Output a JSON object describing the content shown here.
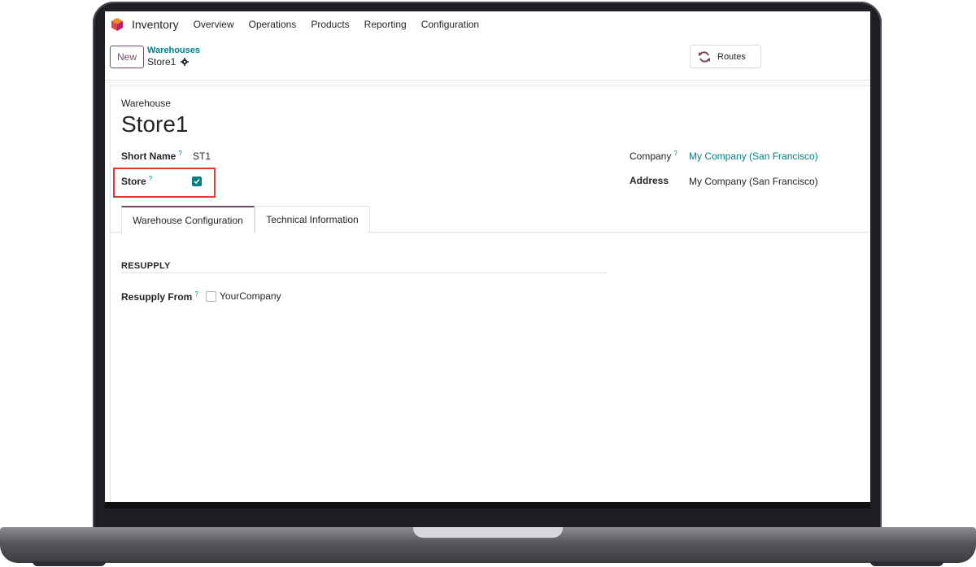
{
  "navbar": {
    "app_name": "Inventory",
    "items": [
      "Overview",
      "Operations",
      "Products",
      "Reporting",
      "Configuration"
    ]
  },
  "control_panel": {
    "new_label": "New",
    "breadcrumb_parent": "Warehouses",
    "breadcrumb_current": "Store1",
    "routes_label": "Routes"
  },
  "form": {
    "model_label": "Warehouse",
    "title": "Store1",
    "short_name_label": "Short Name",
    "short_name_value": "ST1",
    "store_label": "Store",
    "store_checked": true,
    "company_label": "Company",
    "company_value": "My Company (San Francisco)",
    "address_label": "Address",
    "address_value": "My Company (San Francisco)",
    "help_mark": "?"
  },
  "tabs": [
    "Warehouse Configuration",
    "Technical Information"
  ],
  "resupply": {
    "section_title": "RESUPPLY",
    "from_label": "Resupply From",
    "option_label": "YourCompany",
    "option_checked": false
  },
  "colors": {
    "brand": "#714b67",
    "link": "#017e84",
    "highlight": "#e4342f"
  }
}
